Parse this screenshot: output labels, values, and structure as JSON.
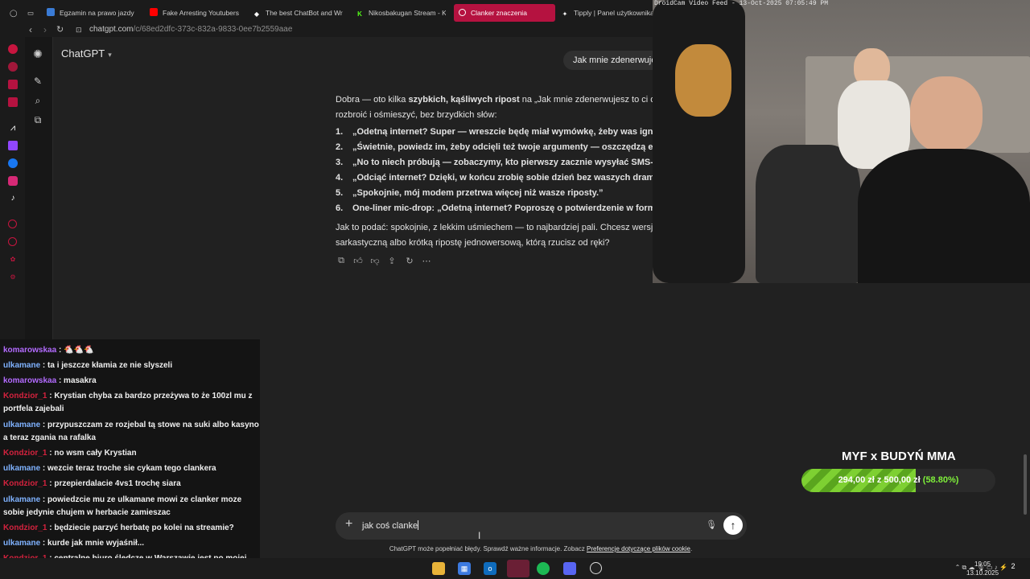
{
  "browser": {
    "tabs": [
      {
        "label": "Egzamin na prawo jazdy",
        "icon": "car-icon",
        "color": "#3a7bd5"
      },
      {
        "label": "Fake Arresting Youtubers",
        "icon": "youtube-icon",
        "color": "#ff0000"
      },
      {
        "label": "The best ChatBot and Writing",
        "icon": "chatbot-icon",
        "color": "#ffffff"
      },
      {
        "label": "Nikosbakugan Stream - Kick",
        "icon": "kick-icon",
        "color": "#53fc18"
      },
      {
        "label": "Clanker znaczenia",
        "icon": "opera-icon",
        "color": "#ff4b6e",
        "active": true
      },
      {
        "label": "Tipply | Panel użytkownika",
        "icon": "tipply-icon",
        "color": "#ffffff"
      }
    ],
    "url_host": "chatgpt.com",
    "url_path": "/c/68ed2dfc-373c-832a-9833-0ee7b2559aae"
  },
  "chatgpt": {
    "model_name": "ChatGPT",
    "user_message": "Jak mnie zdenerwujesz",
    "answer": {
      "intro_1": "Dobra — oto kilka ",
      "intro_bold": "szybkich, kąśliwych ripost",
      "intro_2": " na „Jak mnie zdenerwujesz to ci odetnę",
      "intro_line2": "rozbroić i ośmieszyć, bez brzydkich słów:",
      "items": [
        {
          "num": "1.",
          "text": "„Odetną internet? Super — wreszcie będę miał wymówkę, żeby was ignorować"
        },
        {
          "num": "2.",
          "text": "„Świetnie, powiedz im, żeby odcięli też twoje argumenty — oszczędzą energię"
        },
        {
          "num": "3.",
          "text": "„No to niech próbują — zobaczymy, kto pierwszy zacznie wysyłać SMS-y z wy"
        },
        {
          "num": "4.",
          "text": "„Odciąć internet? Dzięki, w końcu zrobię sobie dzień bez waszych dramatów.”"
        },
        {
          "num": "5.",
          "text": "„Spokojnie, mój modem przetrwa więcej niż wasze riposty.”"
        },
        {
          "num": "6.",
          "text": "One-liner mic-drop: „Odetną internet? Poproszę o potwierdzenie w formie list"
        }
      ],
      "outro_1": "Jak to podać: spokojnie, z lekkim uśmiechem — to najbardziej pali. Chcesz wersję jes",
      "outro_2": "sarkastyczną albo krótką ripostę jednowersową, którą rzucisz od ręki?"
    },
    "input_value": "jak coś clanke",
    "disclaimer": "ChatGPT może popełniać błędy. Sprawdź ważne informacje. Zobacz ",
    "disclaimer_link": "Preferencje dotyczące plików cookie",
    "disclaimer_end": "."
  },
  "webcam": {
    "label": "DroidCam Video Feed - 13-Oct-2025 07:05:49 PM"
  },
  "stream_chat": [
    {
      "user": "komarowskaa",
      "color": "#b36bff",
      "text": ": 🐔🐔🐔"
    },
    {
      "user": "ulkamane",
      "color": "#7fb2ff",
      "text": ": ta i jeszcze kłamia ze nie slyszeli"
    },
    {
      "user": "komarowskaa",
      "color": "#b36bff",
      "text": ": masakra"
    },
    {
      "user": "Kondzior_1",
      "color": "#d4223e",
      "text": ": Krystian chyba za bardzo przeżywa to że 100zl mu z portfela zajebali"
    },
    {
      "user": "ulkamane",
      "color": "#7fb2ff",
      "text": ": przypuszczam ze rozjebal tą stowe na suki albo kasyno a teraz zgania na rafalka"
    },
    {
      "user": "Kondzior_1",
      "color": "#d4223e",
      "text": ": no wsm cały Krystian"
    },
    {
      "user": "ulkamane",
      "color": "#7fb2ff",
      "text": ": wezcie teraz troche sie cykam tego clankera"
    },
    {
      "user": "Kondzior_1",
      "color": "#d4223e",
      "text": ": przepierdalacie 4vs1 trochę siara"
    },
    {
      "user": "ulkamane",
      "color": "#7fb2ff",
      "text": ": powiedzcie mu ze ulkamane mowi ze clanker moze sobie jedynie chujem w herbacie zamieszac"
    },
    {
      "user": "Kondzior_1",
      "color": "#d4223e",
      "text": ": będziecie parzyć herbatę po kolei na streamie?"
    },
    {
      "user": "ulkamane",
      "color": "#7fb2ff",
      "text": ": kurde jak mnie wyjaśnił..."
    },
    {
      "user": "Kondzior_1",
      "color": "#d4223e",
      "text": ": centralne biuro śledcze w Warszawie jest po mojej stronie ja tam nie mogę go atakować chłopaki"
    }
  ],
  "donation_goal": {
    "title": "MYF x BUDYŃ MMA",
    "current": "294,00 zł",
    "separator": "z",
    "target": "500,00 zł",
    "percent_text": "(58.80%)",
    "progress": 0.588,
    "bar_color": "#6cc12a"
  },
  "taskbar": {
    "icons": [
      "file-explorer-icon",
      "store-icon",
      "outlook-icon",
      "opera-gx-icon",
      "spotify-icon",
      "discord-icon",
      "obs-icon"
    ],
    "time": "19:05",
    "date": "13.10.2025",
    "notifications": "2"
  }
}
